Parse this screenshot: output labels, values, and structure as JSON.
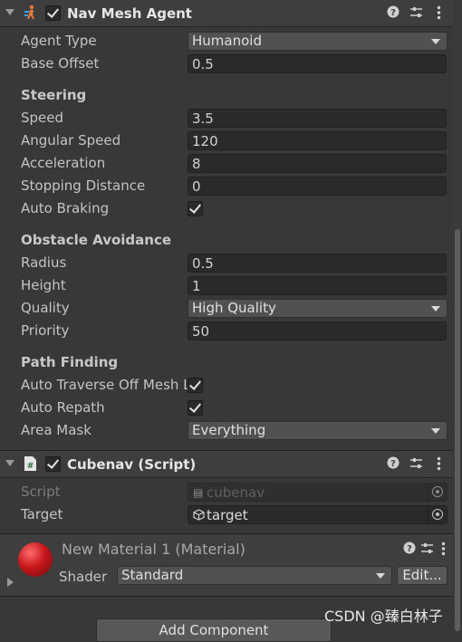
{
  "nav_mesh_agent": {
    "title": "Nav Mesh Agent",
    "enabled": true,
    "agent_type_label": "Agent Type",
    "agent_type_value": "Humanoid",
    "base_offset_label": "Base Offset",
    "base_offset_value": "0.5",
    "steering_title": "Steering",
    "speed_label": "Speed",
    "speed_value": "3.5",
    "angular_speed_label": "Angular Speed",
    "angular_speed_value": "120",
    "acceleration_label": "Acceleration",
    "acceleration_value": "8",
    "stopping_distance_label": "Stopping Distance",
    "stopping_distance_value": "0",
    "auto_braking_label": "Auto Braking",
    "auto_braking_value": true,
    "obstacle_title": "Obstacle Avoidance",
    "radius_label": "Radius",
    "radius_value": "0.5",
    "height_label": "Height",
    "height_value": "1",
    "quality_label": "Quality",
    "quality_value": "High Quality",
    "priority_label": "Priority",
    "priority_value": "50",
    "path_title": "Path Finding",
    "auto_traverse_label": "Auto Traverse Off Mesh L",
    "auto_traverse_value": true,
    "auto_repath_label": "Auto Repath",
    "auto_repath_value": true,
    "area_mask_label": "Area Mask",
    "area_mask_value": "Everything"
  },
  "cubenav": {
    "title": "Cubenav (Script)",
    "enabled": true,
    "script_label": "Script",
    "script_value": "cubenav",
    "target_label": "Target",
    "target_value": "target"
  },
  "material": {
    "title": "New Material 1 (Material)",
    "shader_label": "Shader",
    "shader_value": "Standard",
    "edit_label": "Edit...",
    "color": "#c8171d"
  },
  "add_component_label": "Add Component",
  "watermark": "CSDN @臻白林子",
  "icons": [
    "help-icon",
    "presets-icon",
    "more-icon",
    "fold-arrow-icon",
    "checkmark-icon",
    "target-picker-icon",
    "script-icon",
    "prefab-cube-icon"
  ]
}
